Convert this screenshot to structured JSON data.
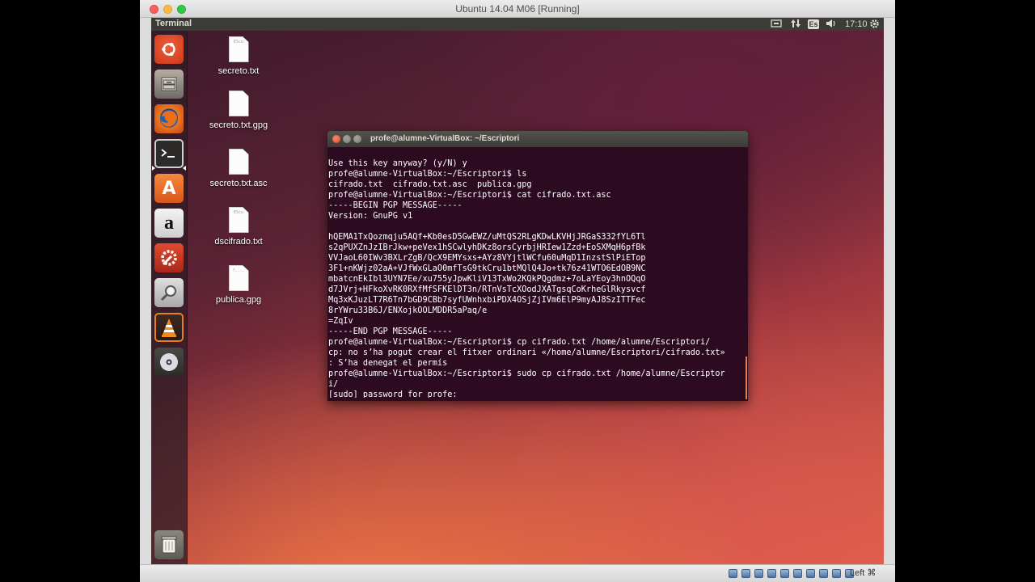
{
  "vbox": {
    "title": "Ubuntu 14.04 M06 [Running]",
    "host_key": "Left ⌘"
  },
  "ubuntu_panel": {
    "title": "Terminal",
    "lang": "Es",
    "clock": "17:10",
    "icons": [
      "network-icon",
      "sort-arrows-icon",
      "keyboard-lang-icon",
      "volume-icon",
      "gear-icon"
    ]
  },
  "launcher": {
    "items": [
      "dash-home",
      "files",
      "firefox",
      "terminal",
      "software-center",
      "amazon",
      "system-settings",
      "search",
      "vlc",
      "dvd",
      "trash"
    ],
    "amazon_letter": "a",
    "store_letter": "A"
  },
  "desktop": {
    "icons": [
      {
        "label": "secreto.txt",
        "thumb": "EScu"
      },
      {
        "label": "secreto.txt.gpg",
        "thumb": ""
      },
      {
        "label": "secreto.txt.asc",
        "thumb": ""
      },
      {
        "label": "dscifrado.txt",
        "thumb": "EScu"
      },
      {
        "label": "publica.gpg",
        "thumb": "?,..."
      }
    ]
  },
  "terminal": {
    "title": "profe@alumne-VirtualBox: ~/Escriptori",
    "lines": [
      "Use this key anyway? (y/N) y",
      "profe@alumne-VirtualBox:~/Escriptori$ ls",
      "cifrado.txt  cifrado.txt.asc  publica.gpg",
      "profe@alumne-VirtualBox:~/Escriptori$ cat cifrado.txt.asc",
      "-----BEGIN PGP MESSAGE-----",
      "Version: GnuPG v1",
      "",
      "hQEMA1TxQozmqju5AQf+Kb0esD5GwEWZ/uMtQS2RLgKDwLKVHjJRGaS332fYL6Tl",
      "s2qPUXZnJzIBrJkw+peVex1hSCwlyhDKz8orsCyrbjHRIew1Zzd+EoSXMqH6pfBk",
      "VVJaoL60IWv3BXLrZgB/QcX9EMYsxs+AYz8VYjtlWCfu60uMqD1InzstSlPiETop",
      "3F1+nKWjz02aA+VJfWxGLaO0mfTsG9tkCru1btMQlQ4Jo+tk76z41WTO6EdOB9NC",
      "mbatcnEkIbl3UYN7Ee/xu755yJpwKliV13TxWo2KQkPQgdmz+7oLaYEoy3hnOQqO",
      "d7JVrj+HFkoXvRK0RXfMfSFKElDT3n/RTnVsTcXOodJXATgsqCoKrheGlRkysvcf",
      "Mq3xKJuzLT7R6Tn7bGD9CBb7syfUWnhxbiPDX4OSjZjIVm6ElP9myAJ8SzITTFec",
      "8rYWru33B6J/ENXojkOOLMDDR5aPaq/e",
      "=ZqIv",
      "-----END PGP MESSAGE-----",
      "profe@alumne-VirtualBox:~/Escriptori$ cp cifrado.txt /home/alumne/Escriptori/",
      "cp: no s’ha pogut crear el fitxer ordinari «/home/alumne/Escriptori/cifrado.txt»",
      ": S’ha denegat el permís",
      "profe@alumne-VirtualBox:~/Escriptori$ sudo cp cifrado.txt /home/alumne/Escriptor",
      "i/",
      "[sudo] password for profe: "
    ]
  },
  "colors": {
    "terminal_bg": "#2c0b21",
    "panel_bg": "#3c3b37",
    "accent_orange": "#e95420"
  }
}
